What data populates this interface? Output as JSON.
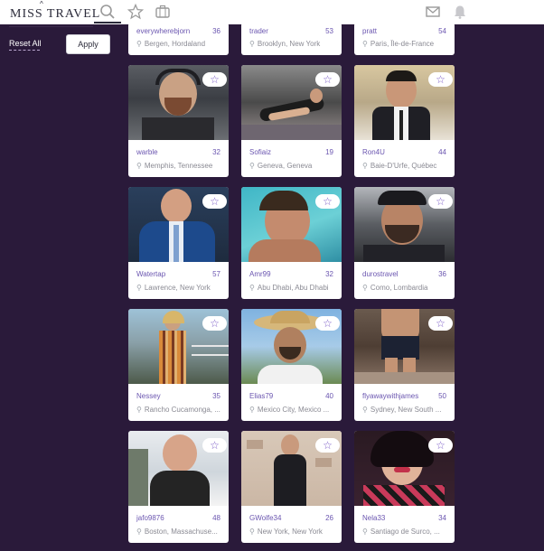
{
  "header": {
    "logo_text": "MISS TRAVEL",
    "logo_mark": "^",
    "icons": [
      "search-icon",
      "star-icon",
      "suitcase-icon",
      "mail-icon",
      "notification-icon"
    ]
  },
  "sidebar": {
    "reset_label": "Reset All",
    "apply_label": "Apply"
  },
  "colors": {
    "background": "#2a1a3a",
    "accent": "#7a5bc7",
    "username": "#6b56b0"
  },
  "profiles": [
    {
      "username": "everywherebjorn",
      "age": "36",
      "location": "Bergen, Hordaland"
    },
    {
      "username": "trader",
      "age": "53",
      "location": "Brooklyn, New York"
    },
    {
      "username": "pratt",
      "age": "54",
      "location": "Paris, Île-de-France"
    },
    {
      "username": "warble",
      "age": "32",
      "location": "Memphis, Tennessee"
    },
    {
      "username": "Sofiaiz",
      "age": "19",
      "location": "Geneva, Geneva"
    },
    {
      "username": "Ron4U",
      "age": "44",
      "location": "Baie-D'Urfe, Québec"
    },
    {
      "username": "Watertap",
      "age": "57",
      "location": "Lawrence, New York"
    },
    {
      "username": "Amr99",
      "age": "32",
      "location": "Abu Dhabi, Abu Dhabi"
    },
    {
      "username": "durostravel",
      "age": "36",
      "location": "Como, Lombardia"
    },
    {
      "username": "Nessey",
      "age": "35",
      "location": "Rancho Cucamonga, ..."
    },
    {
      "username": "Elias79",
      "age": "40",
      "location": "Mexico City, Mexico ..."
    },
    {
      "username": "flyawaywithjames",
      "age": "50",
      "location": "Sydney, New South ..."
    },
    {
      "username": "jafo9876",
      "age": "48",
      "location": "Boston, Massachuse..."
    },
    {
      "username": "GWolfe34",
      "age": "26",
      "location": "New York, New York"
    },
    {
      "username": "Nela33",
      "age": "34",
      "location": "Santiago de Surco, ..."
    }
  ],
  "card_icons": {
    "favorite": "☆",
    "pin": "⚲"
  }
}
